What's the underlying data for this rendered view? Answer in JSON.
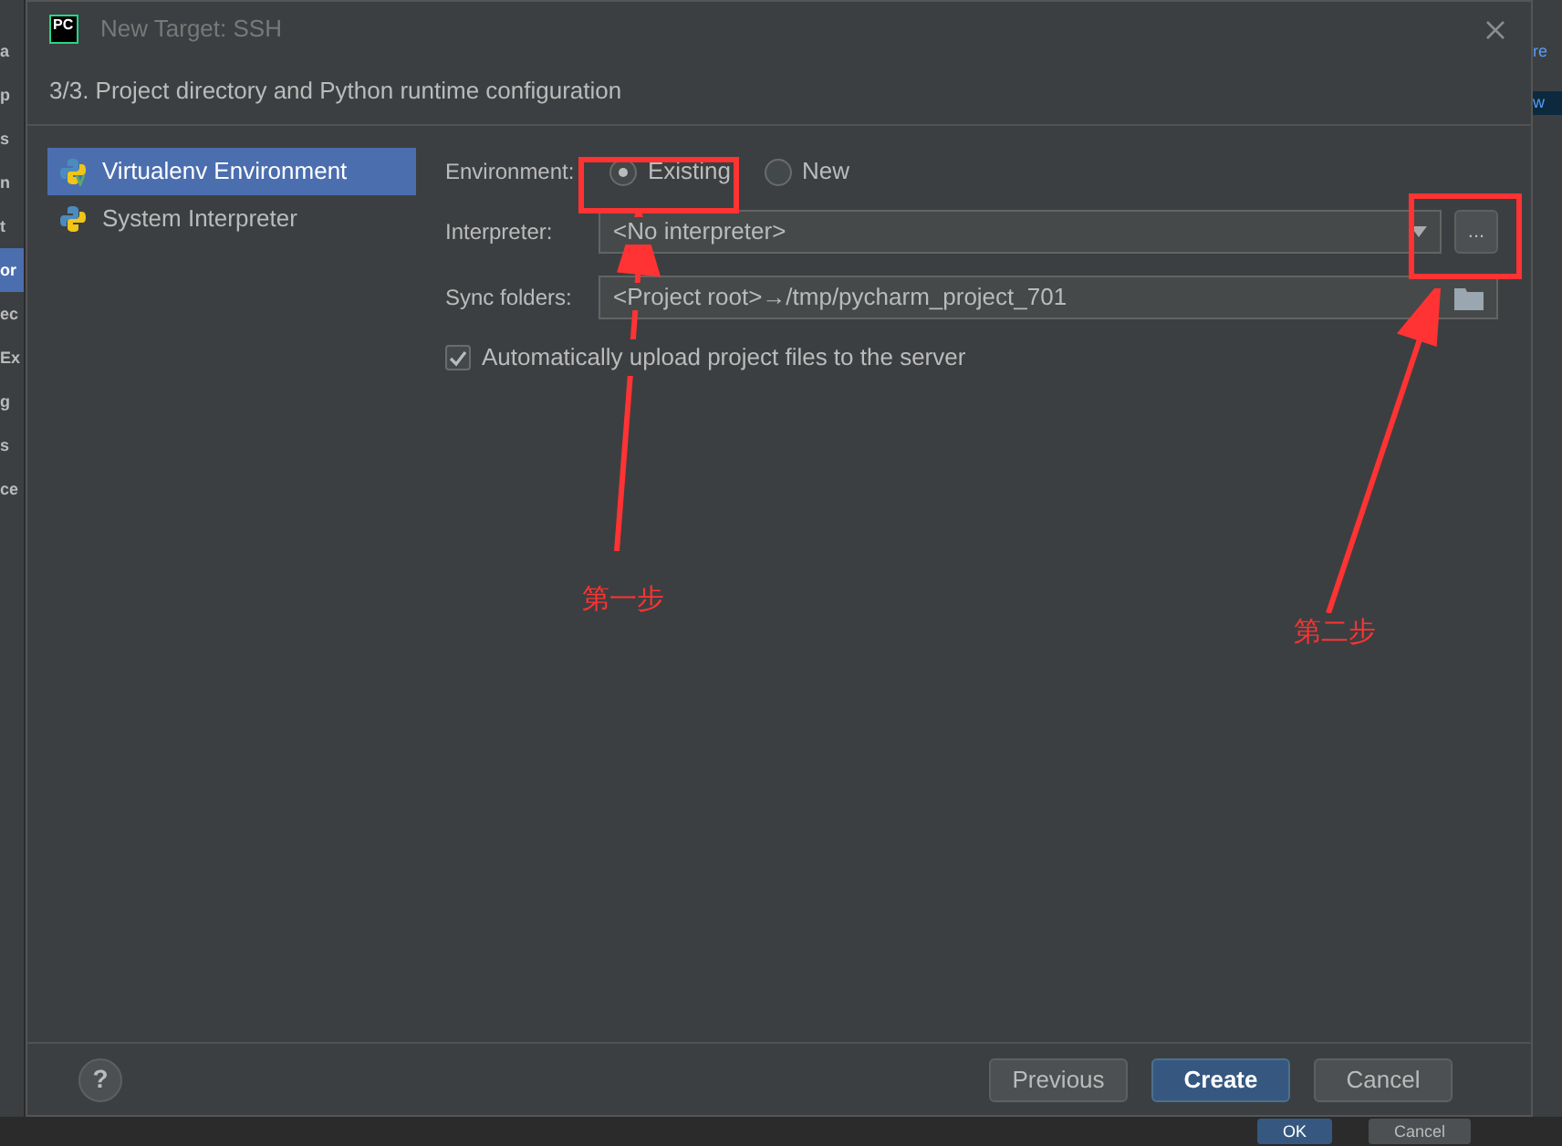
{
  "background": {
    "left_fragments": [
      {
        "text": "a",
        "selected": false
      },
      {
        "text": "p",
        "selected": false
      },
      {
        "text": "s",
        "selected": false
      },
      {
        "text": "n",
        "selected": false
      },
      {
        "text": "t",
        "selected": false
      },
      {
        "text": "or",
        "selected": true
      },
      {
        "text": "ec",
        "selected": false
      },
      {
        "text": "Ex",
        "selected": false
      },
      {
        "text": "g",
        "selected": false
      },
      {
        "text": "s",
        "selected": false
      },
      {
        "text": "ce",
        "selected": false
      }
    ],
    "right_fragments": [
      "re",
      "w"
    ],
    "bottom_buttons": [
      "OK",
      "Cancel"
    ]
  },
  "window": {
    "logo_text": "PC",
    "title": "New Target: SSH"
  },
  "step_title": "3/3. Project directory and Python runtime configuration",
  "sidebar": {
    "items": [
      {
        "label": "Virtualenv Environment",
        "selected": true,
        "kind": "virtualenv"
      },
      {
        "label": "System Interpreter",
        "selected": false,
        "kind": "system"
      }
    ]
  },
  "form": {
    "environment": {
      "label": "Environment:",
      "options": [
        {
          "label": "Existing",
          "selected": true
        },
        {
          "label": "New",
          "selected": false
        }
      ]
    },
    "interpreter": {
      "label": "Interpreter:",
      "value": "<No interpreter>",
      "browse_button": "..."
    },
    "sync_folders": {
      "label": "Sync folders:",
      "value": "<Project root>→/tmp/pycharm_project_701"
    },
    "auto_upload": {
      "label": "Automatically upload project files to the server",
      "checked": true
    }
  },
  "footer": {
    "help": "?",
    "buttons": [
      {
        "label": "Previous",
        "kind": "default"
      },
      {
        "label": "Create",
        "kind": "primary"
      },
      {
        "label": "Cancel",
        "kind": "default"
      }
    ]
  },
  "annotations": [
    {
      "label": "第一步"
    },
    {
      "label": "第二步"
    }
  ]
}
